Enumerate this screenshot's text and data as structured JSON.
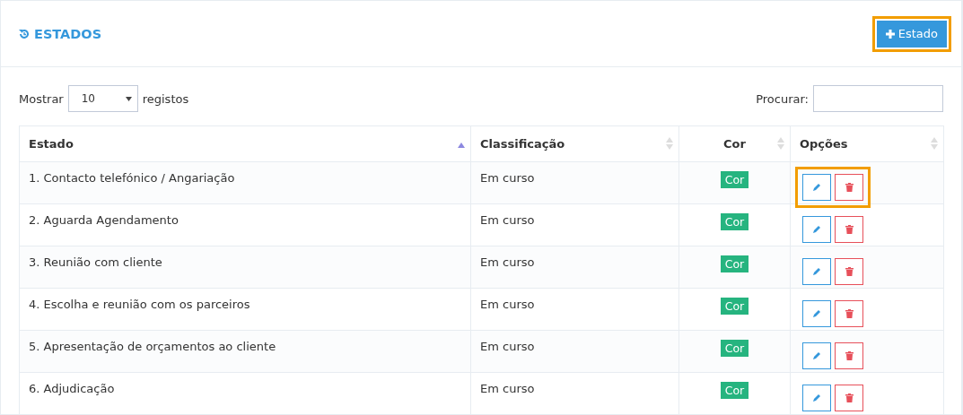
{
  "header": {
    "title": "ESTADOS",
    "add_button": {
      "label": "Estado",
      "highlighted": true
    }
  },
  "length_control": {
    "prefix": "Mostrar",
    "value": "10",
    "suffix": "registos"
  },
  "search": {
    "label": "Procurar:"
  },
  "table": {
    "columns": [
      {
        "label": "Estado",
        "sorted": true
      },
      {
        "label": "Classificação",
        "sorted": false
      },
      {
        "label": "Cor",
        "sorted": false
      },
      {
        "label": "Opções",
        "sorted": false
      }
    ],
    "rows": [
      {
        "estado": "1. Contacto telefónico / Angariação",
        "classificacao": "Em curso",
        "cor": {
          "label": "Cor",
          "color": "#26b47f"
        },
        "actions_highlighted": true
      },
      {
        "estado": "2. Aguarda Agendamento",
        "classificacao": "Em curso",
        "cor": {
          "label": "Cor",
          "color": "#26b47f"
        },
        "actions_highlighted": false
      },
      {
        "estado": "3. Reunião com cliente",
        "classificacao": "Em curso",
        "cor": {
          "label": "Cor",
          "color": "#26b47f"
        },
        "actions_highlighted": false
      },
      {
        "estado": "4. Escolha e reunião com os parceiros",
        "classificacao": "Em curso",
        "cor": {
          "label": "Cor",
          "color": "#26b47f"
        },
        "actions_highlighted": false
      },
      {
        "estado": "5. Apresentação de orçamentos ao cliente",
        "classificacao": "Em curso",
        "cor": {
          "label": "Cor",
          "color": "#26b47f"
        },
        "actions_highlighted": false
      },
      {
        "estado": "6. Adjudicação",
        "classificacao": "Em curso",
        "cor": {
          "label": "Cor",
          "color": "#26b47f"
        },
        "actions_highlighted": false
      }
    ]
  }
}
